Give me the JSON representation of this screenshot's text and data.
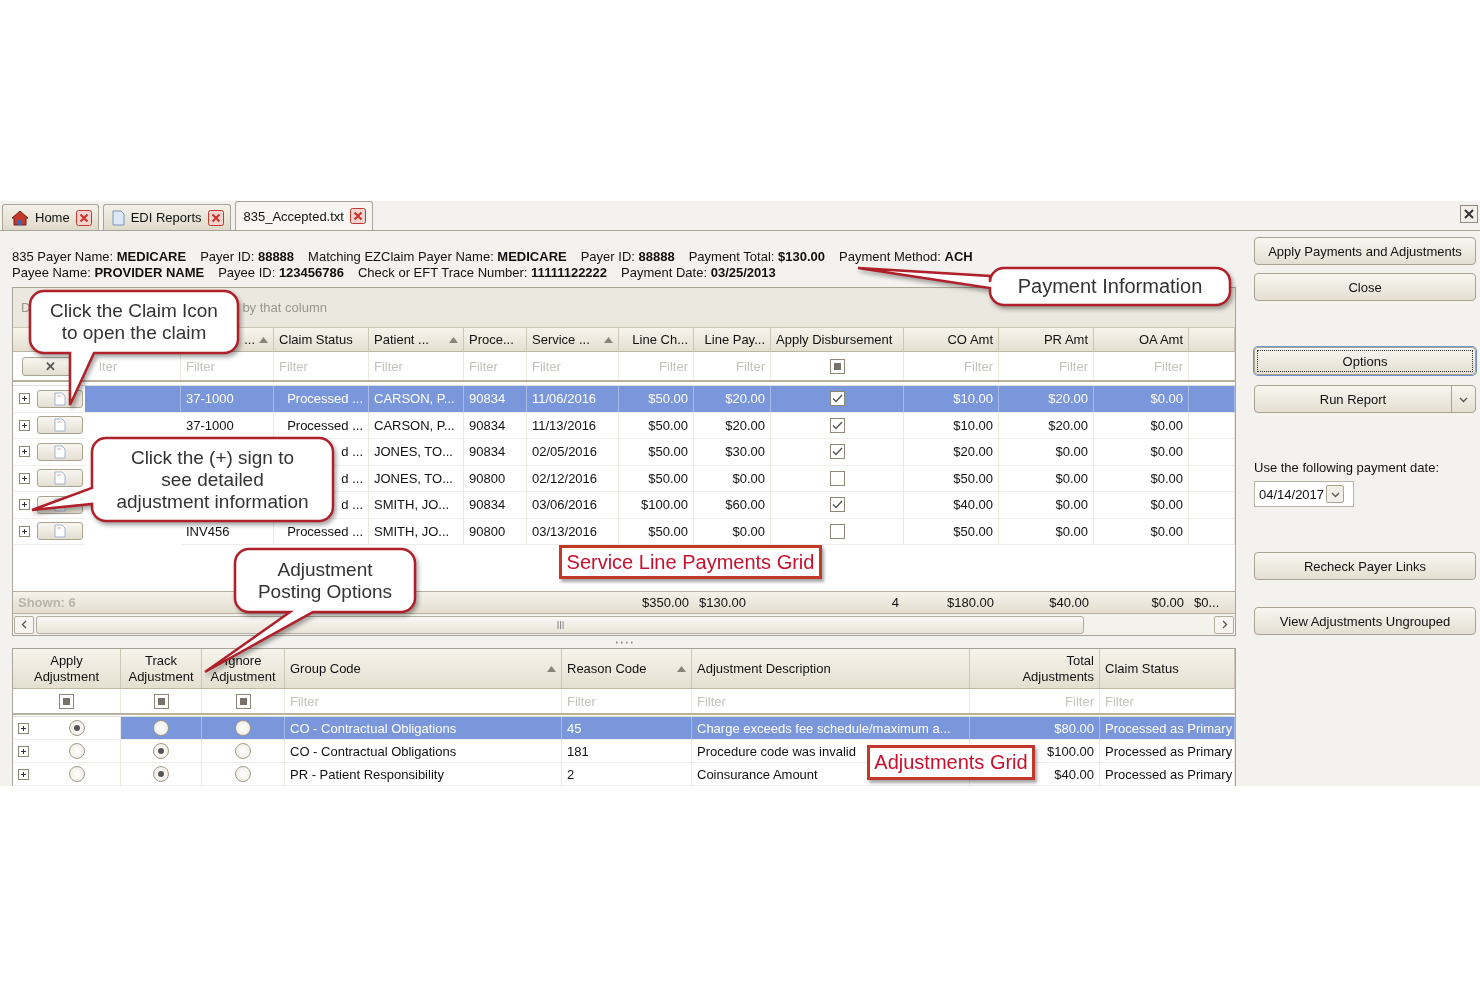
{
  "tabs": [
    {
      "label": "Home",
      "selected": false
    },
    {
      "label": "EDI Reports",
      "selected": false
    },
    {
      "label": "835_Accepted.txt",
      "selected": true
    }
  ],
  "info_lines": [
    [
      "835 Payer Name: **MEDICARE**",
      "Payer ID: **88888**",
      "Matching EZClaim Payer Name: **MEDICARE**",
      "Payer ID: **88888**",
      "Payment Total: **$130.00**",
      "Payment Method: **ACH**"
    ],
    [
      "Payee Name: **PROVIDER NAME**",
      "Payee ID: **123456786**",
      "Check or EFT Trace Number: **11111122222**",
      "Payment Date: **03/25/2013**"
    ]
  ],
  "payments_grid": {
    "group_hint_start": "D",
    "group_hint_end": "by that column",
    "clear_filter": "✕",
    "columns": [
      {
        "kind": "text",
        "filter": "lter"
      },
      {
        "kind": "text",
        "label": "...",
        "filter": "Filter",
        "sorted": true
      },
      {
        "kind": "status",
        "label": "Claim Status",
        "filter": "Filter"
      },
      {
        "kind": "text",
        "label": "Patient ...",
        "filter": "Filter",
        "sorted": true
      },
      {
        "kind": "text",
        "label": "Proce...",
        "filter": "Filter"
      },
      {
        "kind": "text",
        "label": "Service ...",
        "filter": "Filter",
        "sorted": true
      },
      {
        "kind": "money",
        "label": "Line Ch...",
        "filter": "Filter"
      },
      {
        "kind": "money",
        "label": "Line Pay...",
        "filter": "Filter"
      },
      {
        "kind": "check",
        "label": "Apply Disbursement",
        "filter_indeterminate": true
      },
      {
        "kind": "money",
        "label": "CO Amt",
        "filter": "Filter"
      },
      {
        "kind": "money",
        "label": "PR Amt",
        "filter": "Filter"
      },
      {
        "kind": "money",
        "label": "OA Amt",
        "filter": "Filter"
      }
    ],
    "rows": [
      {
        "selected": true,
        "cells": [
          null,
          "37-1000",
          "Processed ...",
          "CARSON, P...",
          "90834",
          "11/06/2016",
          "$50.00",
          "$20.00",
          true,
          "$10.00",
          "$20.00",
          "$0.00"
        ]
      },
      {
        "selected": false,
        "cells": [
          null,
          "37-1000",
          "Processed ...",
          "CARSON, P...",
          "90834",
          "11/13/2016",
          "$50.00",
          "$20.00",
          true,
          "$10.00",
          "$20.00",
          "$0.00"
        ]
      },
      {
        "selected": false,
        "cells": [
          null,
          null,
          "d ...",
          "JONES, TO...",
          "90834",
          "02/05/2016",
          "$50.00",
          "$30.00",
          true,
          "$20.00",
          "$0.00",
          "$0.00"
        ]
      },
      {
        "selected": false,
        "cells": [
          null,
          null,
          "d ...",
          "JONES, TO...",
          "90800",
          "02/12/2016",
          "$50.00",
          "$0.00",
          false,
          "$50.00",
          "$0.00",
          "$0.00"
        ]
      },
      {
        "selected": false,
        "cells": [
          null,
          null,
          "d ...",
          "SMITH, JO...",
          "90834",
          "03/06/2016",
          "$100.00",
          "$60.00",
          true,
          "$40.00",
          "$0.00",
          "$0.00"
        ]
      },
      {
        "selected": false,
        "cells": [
          null,
          "INV456",
          "Processed ...",
          "SMITH, JO...",
          "90800",
          "03/13/2016",
          "$50.00",
          "$0.00",
          false,
          "$50.00",
          "$0.00",
          "$0.00"
        ]
      }
    ],
    "summary": {
      "shown": "Shown: 6",
      "totals": [
        "$350.00",
        "$130.00",
        "4",
        "$180.00",
        "$40.00",
        "$0.00",
        "$0..."
      ]
    }
  },
  "adjustments_grid": {
    "option_columns": [
      {
        "label": "Apply\nAdjustment",
        "filter_indeterminate": true
      },
      {
        "label": "Track\nAdjustment",
        "filter_indeterminate": true
      },
      {
        "label": "Ignore\nAdjustment",
        "filter_indeterminate": true
      }
    ],
    "columns": [
      {
        "kind": "text",
        "label": "Group Code",
        "filter": "Filter",
        "sorted": true
      },
      {
        "kind": "text",
        "label": "Reason Code",
        "filter": "Filter",
        "sorted": true
      },
      {
        "kind": "text",
        "label": "Adjustment Description",
        "filter": "Filter"
      },
      {
        "kind": "money",
        "label": "Total\nAdjustments",
        "filter": "Filter"
      },
      {
        "kind": "text",
        "label": "Claim Status",
        "filter": "Filter"
      }
    ],
    "rows": [
      {
        "selected": true,
        "options": [
          {
            "selected": true
          },
          {
            "selected": false
          },
          {
            "selected": false
          }
        ],
        "cells": [
          "CO - Contractual Obligations",
          "45",
          "Charge exceeds fee schedule/maximum a...",
          "$80.00",
          "Processed as Primary"
        ]
      },
      {
        "selected": false,
        "options": [
          {
            "selected": false
          },
          {
            "selected": true
          },
          {
            "selected": false
          }
        ],
        "cells": [
          "CO - Contractual Obligations",
          "181",
          "Procedure code was invalid",
          "$100.00",
          "Processed as Primary"
        ]
      },
      {
        "selected": false,
        "options": [
          {
            "selected": false
          },
          {
            "selected": true
          },
          {
            "selected": false
          }
        ],
        "cells": [
          "PR - Patient Responsibility",
          "2",
          "Coinsurance Amount",
          "$40.00",
          "Processed as Primary"
        ]
      }
    ]
  },
  "actions": {
    "apply": "Apply Payments and Adjustments",
    "close": "Close",
    "options": "Options",
    "run_report": "Run Report",
    "date_label": "Use the following payment date:",
    "date_value": "04/14/2017",
    "recheck": "Recheck Payer Links",
    "view_ungrouped": "View Adjustments Ungrouped"
  },
  "callouts": [
    {
      "text": "Click the Claim Icon\nto open the claim"
    },
    {
      "text": "Click the (+) sign to\nsee detailed\nadjustment information"
    },
    {
      "text": "Adjustment\nPosting Options"
    },
    {
      "text": "Payment Information"
    }
  ],
  "grid_labels": [
    "Service Line Payments Grid",
    "Adjustments Grid"
  ]
}
